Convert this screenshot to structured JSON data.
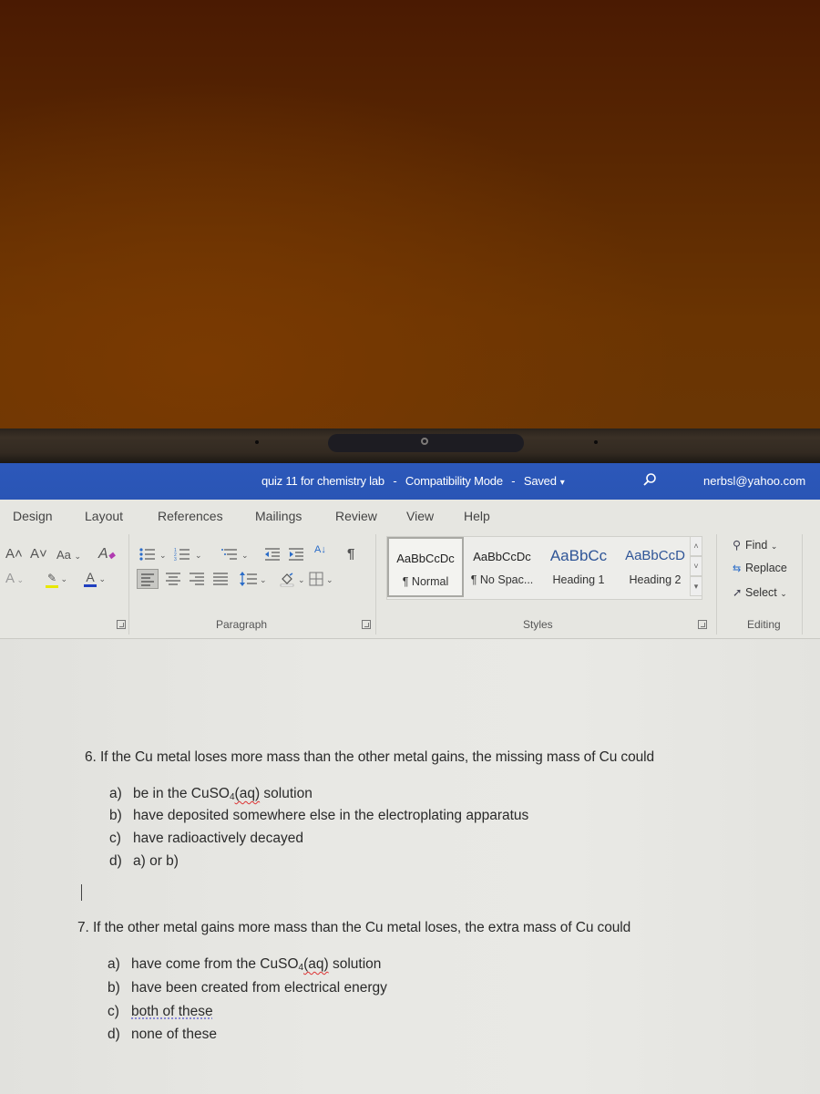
{
  "window": {
    "document_name": "quiz 11 for chemistry lab",
    "separator": "-",
    "mode": "Compatibility Mode",
    "save_status": "Saved",
    "save_caret": "▾",
    "account": "nerbsl@yahoo.com"
  },
  "ribbon": {
    "tabs": [
      "Design",
      "Layout",
      "References",
      "Mailings",
      "Review",
      "View",
      "Help"
    ],
    "font_group": {
      "grow_font": "A˄",
      "shrink_font": "A˅",
      "change_case": "Aa",
      "clear_formatting": "A",
      "text_effects": "A",
      "highlight": "✎",
      "font_color": "A",
      "highlight_color": "#e8e800",
      "font_color_bar": "#2040c0"
    },
    "paragraph_group": {
      "label": "Paragraph",
      "pilcrow": "¶",
      "sort": "A↓"
    },
    "styles_group": {
      "label": "Styles",
      "items": [
        {
          "sample": "AaBbCcDc",
          "name": "¶ Normal",
          "selected": true
        },
        {
          "sample": "AaBbCcDc",
          "name": "¶ No Spac...",
          "selected": false
        },
        {
          "sample": "AaBbCc",
          "name": "Heading 1",
          "selected": false
        },
        {
          "sample": "AaBbCcD",
          "name": "Heading 2",
          "selected": false
        }
      ]
    },
    "editing_group": {
      "label": "Editing",
      "find": "Find",
      "replace": "Replace",
      "select": "Select"
    }
  },
  "document": {
    "questions": [
      {
        "number": "6.",
        "text": "If the Cu metal loses more mass than the other metal gains, the missing mass of Cu could",
        "options": [
          {
            "label": "a)",
            "pre": "be in the CuSO",
            "sub": "4",
            "flagged": "(aq)",
            "post": " solution"
          },
          {
            "label": "b)",
            "text": "have deposited somewhere else in the electroplating apparatus"
          },
          {
            "label": "c)",
            "text": "have radioactively decayed"
          },
          {
            "label": "d)",
            "text": "a) or b)"
          }
        ]
      },
      {
        "number": "7.",
        "text": "If the other metal gains more mass than the Cu metal loses, the extra mass of Cu could",
        "options": [
          {
            "label": "a)",
            "pre": "have come from the CuSO",
            "sub": "4",
            "flagged": "(aq)",
            "post": " solution"
          },
          {
            "label": "b)",
            "text": "have been created from electrical energy"
          },
          {
            "label": "c)",
            "text": "both of these"
          },
          {
            "label": "d)",
            "text": "none of these"
          }
        ]
      }
    ]
  }
}
